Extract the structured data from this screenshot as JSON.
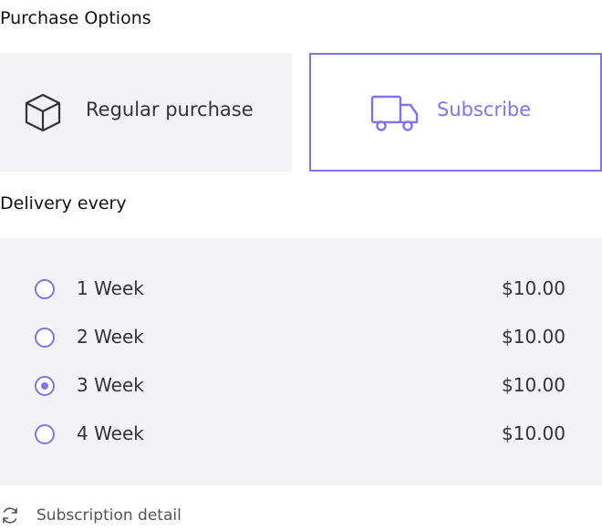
{
  "colors": {
    "accent": "#8174ea",
    "panel_bg": "#f3f3f5",
    "text": "#333333"
  },
  "purchase_options": {
    "heading": "Purchase Options",
    "options": [
      {
        "label": "Regular purchase",
        "icon": "box-icon",
        "selected": false
      },
      {
        "label": "Subscribe",
        "icon": "truck-icon",
        "selected": true
      }
    ]
  },
  "delivery": {
    "heading": "Delivery every",
    "options": [
      {
        "label": "1 Week",
        "price": "$10.00",
        "selected": false
      },
      {
        "label": "2 Week",
        "price": "$10.00",
        "selected": false
      },
      {
        "label": "3 Week",
        "price": "$10.00",
        "selected": true
      },
      {
        "label": "4 Week",
        "price": "$10.00",
        "selected": false
      }
    ]
  },
  "subscription_detail": {
    "label": "Subscription detail",
    "icon": "refresh-icon"
  }
}
